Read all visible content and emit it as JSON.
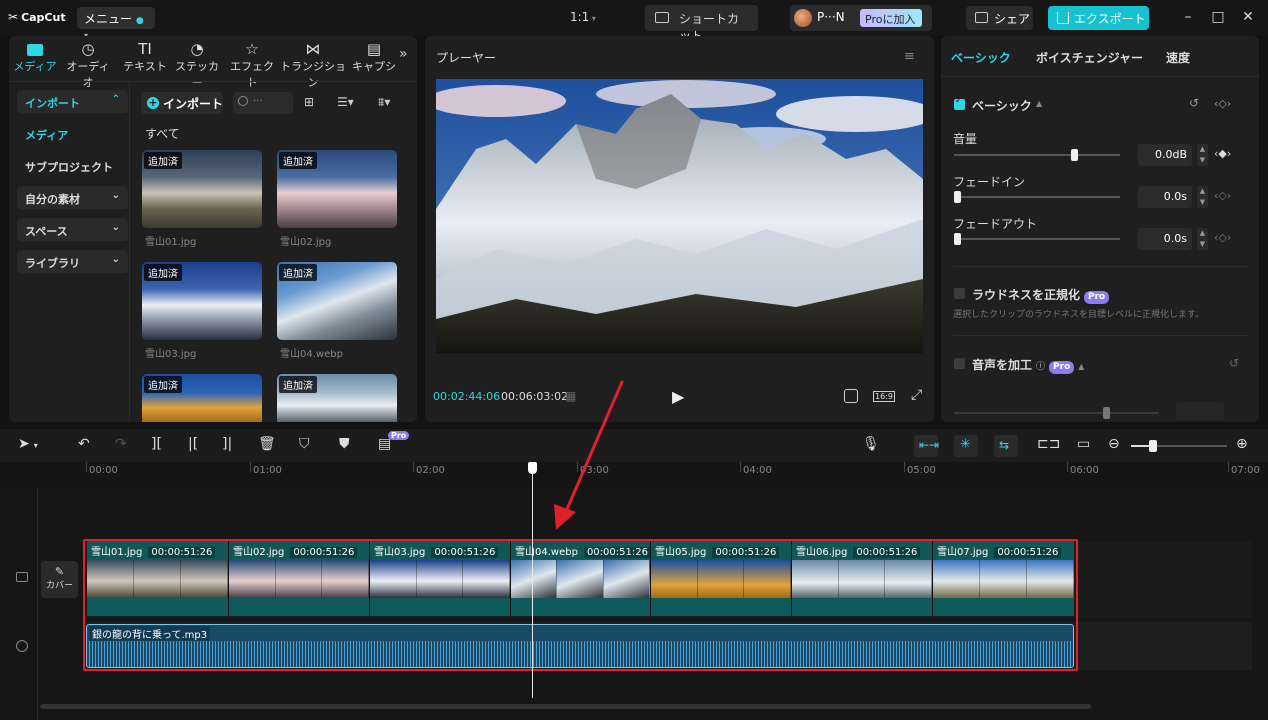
{
  "app": {
    "logo": "CapCut",
    "menu": "メニュー",
    "ratio": "1:1",
    "shortcut": "ショートカット",
    "user": "P···N",
    "pro_join": "Proに加入",
    "share": "シェア",
    "export": "エクスポート"
  },
  "media_tabs": [
    {
      "label": "メディア"
    },
    {
      "label": "オーディオ"
    },
    {
      "label": "テキスト"
    },
    {
      "label": "ステッカー"
    },
    {
      "label": "エフェクト"
    },
    {
      "label": "トランジション"
    },
    {
      "label": "キャプシ"
    }
  ],
  "sidebar": {
    "import": "インポート",
    "media": "メディア",
    "subproject": "サブプロジェクト",
    "my_materials": "自分の素材",
    "space": "スペース",
    "library": "ライブラリ"
  },
  "media": {
    "import_button": "インポート",
    "search_placeholder": "···",
    "all_label": "すべて",
    "added_tag": "追加済",
    "items": [
      {
        "name": "雪山01.jpg"
      },
      {
        "name": "雪山02.jpg"
      },
      {
        "name": "雪山03.jpg"
      },
      {
        "name": "雪山04.webp"
      },
      {
        "name": ""
      },
      {
        "name": ""
      }
    ]
  },
  "player": {
    "title": "プレーヤー",
    "current_time": "00:02:44:06",
    "total_time": "00:06:03:02",
    "ratio": "16:9"
  },
  "props": {
    "tabs": [
      "ベーシック",
      "ボイスチェンジャー",
      "速度"
    ],
    "section": "ベーシック",
    "volume_label": "音量",
    "volume_value": "0.0dB",
    "volume_level": 0.72,
    "fade_in_label": "フェードイン",
    "fade_in_value": "0.0s",
    "fade_out_label": "フェードアウト",
    "fade_out_value": "0.0s",
    "loudness_label": "ラウドネスを正規化",
    "loudness_badge": "Pro",
    "loudness_desc": "選択したクリップのラウドネスを目標レベルに正規化します。",
    "voice_label": "音声を加工",
    "voice_badge": "Pro"
  },
  "toolbar": {
    "pro_badge": "Pro"
  },
  "timeline": {
    "ruler": [
      "00:00",
      "01:00",
      "02:00",
      "03:00",
      "04:00",
      "05:00",
      "06:00",
      "07:00"
    ],
    "cover_label": "カバー",
    "clips": [
      {
        "name": "雪山01.jpg",
        "dur": "00:00:51:26"
      },
      {
        "name": "雪山02.jpg",
        "dur": "00:00:51:26"
      },
      {
        "name": "雪山03.jpg",
        "dur": "00:00:51:26"
      },
      {
        "name": "雪山04.webp",
        "dur": "00:00:51:26"
      },
      {
        "name": "雪山05.jpg",
        "dur": "00:00:51:26"
      },
      {
        "name": "雪山06.jpg",
        "dur": "00:00:51:26"
      },
      {
        "name": "雪山07.jpg",
        "dur": "00:00:51:26"
      }
    ],
    "audio": {
      "name": "銀の龍の背に乗って.mp3"
    }
  },
  "colors": {
    "accent": "#2fd6e6",
    "highlight": "#e0202a"
  }
}
